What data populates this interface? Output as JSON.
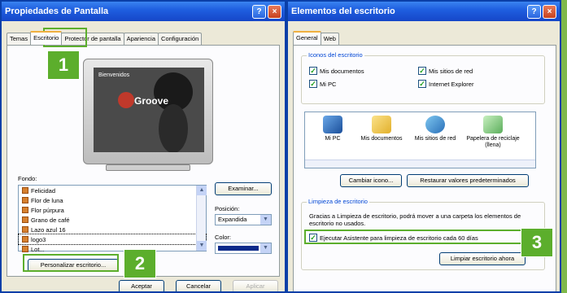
{
  "left_window": {
    "title": "Propiedades de Pantalla",
    "help_icon": "?",
    "close_icon": "×",
    "tabs": [
      "Temas",
      "Escritorio",
      "Protector de pantalla",
      "Apariencia",
      "Configuración"
    ],
    "fondo_label": "Fondo:",
    "backgrounds": [
      "Felicidad",
      "Flor de luna",
      "Flor púrpura",
      "Grano de café",
      "Lazo azul 16",
      "logo3",
      "Lot..."
    ],
    "selected_background": "logo3",
    "browse_button": "Examinar...",
    "position_label": "Posición:",
    "position_value": "Expandida",
    "color_label": "Color:",
    "customize_button": "Personalizar escritorio...",
    "ok_button": "Aceptar",
    "cancel_button": "Cancelar",
    "apply_button": "Aplicar",
    "preview_text": "Groove",
    "preview_sub": "Bienvenidos"
  },
  "right_window": {
    "title": "Elementos del escritorio",
    "help_icon": "?",
    "close_icon": "×",
    "tabs": [
      "General",
      "Web"
    ],
    "icons_group": "Iconos del escritorio",
    "checkboxes": [
      "Mis documentos",
      "Mis sitios de red",
      "Mi PC",
      "Internet Explorer"
    ],
    "desktop_icons": [
      "Mi PC",
      "Mis documentos",
      "Mis sitios de red",
      "Papelera de reciclaje (llena)"
    ],
    "change_icon_button": "Cambiar icono...",
    "restore_button": "Restaurar valores predeterminados",
    "cleanup_group": "Limpieza de escritorio",
    "cleanup_text": "Gracias a Limpieza de escritorio, podrá mover a una carpeta los elementos de escritorio no usados.",
    "cleanup_checkbox": "Ejecutar Asistente para limpieza de escritorio cada 60 días",
    "clean_now_button": "Limpiar escritorio ahora"
  },
  "badges": [
    "1",
    "2",
    "3"
  ],
  "colors": {
    "accent_green": "#5cae2c",
    "title_blue": "#1f5fe0",
    "color_swatch": "#0a2a8a"
  }
}
